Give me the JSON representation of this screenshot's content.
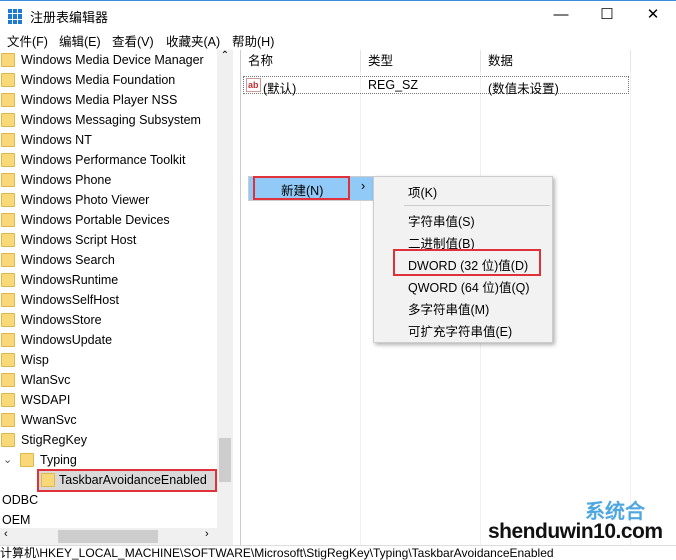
{
  "window": {
    "title": "注册表编辑器",
    "minimize": "—",
    "maximize": "☐",
    "close": "✕"
  },
  "menubar": [
    "文件(F)",
    "编辑(E)",
    "查看(V)",
    "收藏夹(A)",
    "帮助(H)"
  ],
  "tree": {
    "items": [
      "Windows Media Device Manager",
      "Windows Media Foundation",
      "Windows Media Player NSS",
      "Windows Messaging Subsystem",
      "Windows NT",
      "Windows Performance Toolkit",
      "Windows Phone",
      "Windows Photo Viewer",
      "Windows Portable Devices",
      "Windows Script Host",
      "Windows Search",
      "WindowsRuntime",
      "WindowsSelfHost",
      "WindowsStore",
      "WindowsUpdate",
      "Wisp",
      "WlanSvc",
      "WSDAPI",
      "WwanSvc",
      "StigRegKey"
    ],
    "expanded": "Typing",
    "selected": "TaskbarAvoidanceEnabled",
    "after": [
      "ODBC",
      "OEM"
    ]
  },
  "list": {
    "columns": [
      "名称",
      "类型",
      "数据"
    ],
    "rows": [
      {
        "name": "(默认)",
        "type": "REG_SZ",
        "data": "(数值未设置)"
      }
    ]
  },
  "context_menu": {
    "new": "新建(N)",
    "arrow": "›"
  },
  "submenu": [
    "项(K)",
    "字符串值(S)",
    "二进制值(B)",
    "DWORD (32 位)值(D)",
    "QWORD (64 位)值(Q)",
    "多字符串值(M)",
    "可扩充字符串值(E)"
  ],
  "status": "计算机\\HKEY_LOCAL_MACHINE\\SOFTWARE\\Microsoft\\StigRegKey\\Typing\\TaskbarAvoidanceEnabled",
  "watermark": {
    "text": "shenduwin10.com",
    "logo": "系统合"
  },
  "colors": {
    "highlight": "#91c9f7",
    "annotation": "#e0303a"
  }
}
